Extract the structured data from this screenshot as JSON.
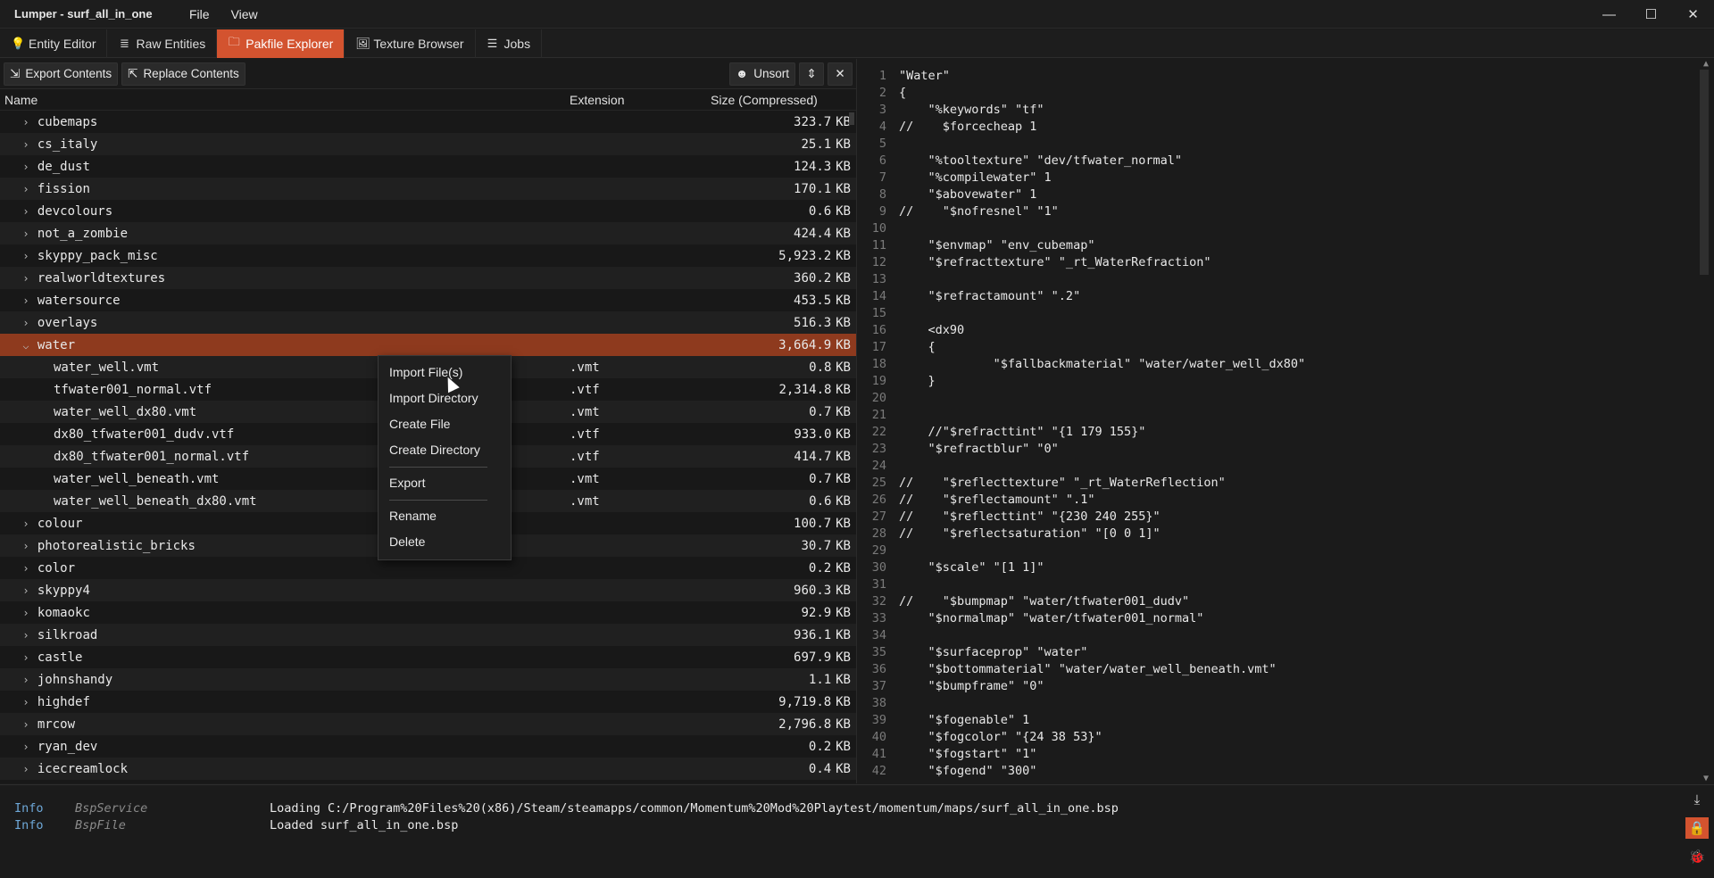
{
  "titlebar": {
    "title": "Lumper - surf_all_in_one",
    "menu": [
      "File",
      "View"
    ],
    "controls": {
      "minimize": "—",
      "maximize": "☐",
      "close": "✕"
    }
  },
  "tabs": [
    {
      "label": "Entity Editor",
      "icon": "bulb-icon",
      "glyph": "💡",
      "active": false
    },
    {
      "label": "Raw Entities",
      "icon": "list-icon",
      "glyph": "≣",
      "active": false
    },
    {
      "label": "Pakfile Explorer",
      "icon": "folder-icon",
      "glyph": "🗀",
      "active": true
    },
    {
      "label": "Texture Browser",
      "icon": "image-icon",
      "glyph": "🖼",
      "active": false
    },
    {
      "label": "Jobs",
      "icon": "jobs-icon",
      "glyph": "☰",
      "active": false
    }
  ],
  "toolbar": {
    "export_label": "Export Contents",
    "replace_label": "Replace Contents",
    "unsort_label": "Unsort"
  },
  "columns": {
    "name": "Name",
    "extension": "Extension",
    "size": "Size (Compressed)"
  },
  "rows": [
    {
      "name": "cubemaps",
      "ext": "",
      "size": "323.7",
      "unit": "KB",
      "type": "folder"
    },
    {
      "name": "cs_italy",
      "ext": "",
      "size": "25.1",
      "unit": "KB",
      "type": "folder"
    },
    {
      "name": "de_dust",
      "ext": "",
      "size": "124.3",
      "unit": "KB",
      "type": "folder"
    },
    {
      "name": "fission",
      "ext": "",
      "size": "170.1",
      "unit": "KB",
      "type": "folder"
    },
    {
      "name": "devcolours",
      "ext": "",
      "size": "0.6",
      "unit": "KB",
      "type": "folder"
    },
    {
      "name": "not_a_zombie",
      "ext": "",
      "size": "424.4",
      "unit": "KB",
      "type": "folder"
    },
    {
      "name": "skyppy_pack_misc",
      "ext": "",
      "size": "5,923.2",
      "unit": "KB",
      "type": "folder"
    },
    {
      "name": "realworldtextures",
      "ext": "",
      "size": "360.2",
      "unit": "KB",
      "type": "folder"
    },
    {
      "name": "watersource",
      "ext": "",
      "size": "453.5",
      "unit": "KB",
      "type": "folder"
    },
    {
      "name": "overlays",
      "ext": "",
      "size": "516.3",
      "unit": "KB",
      "type": "folder"
    },
    {
      "name": "water",
      "ext": "",
      "size": "3,664.9",
      "unit": "KB",
      "type": "open",
      "selected": true
    },
    {
      "name": "water_well.vmt",
      "ext": ".vmt",
      "size": "0.8",
      "unit": "KB",
      "type": "file"
    },
    {
      "name": "tfwater001_normal.vtf",
      "ext": ".vtf",
      "size": "2,314.8",
      "unit": "KB",
      "type": "file"
    },
    {
      "name": "water_well_dx80.vmt",
      "ext": ".vmt",
      "size": "0.7",
      "unit": "KB",
      "type": "file"
    },
    {
      "name": "dx80_tfwater001_dudv.vtf",
      "ext": ".vtf",
      "size": "933.0",
      "unit": "KB",
      "type": "file"
    },
    {
      "name": "dx80_tfwater001_normal.vtf",
      "ext": ".vtf",
      "size": "414.7",
      "unit": "KB",
      "type": "file"
    },
    {
      "name": "water_well_beneath.vmt",
      "ext": ".vmt",
      "size": "0.7",
      "unit": "KB",
      "type": "file"
    },
    {
      "name": "water_well_beneath_dx80.vmt",
      "ext": ".vmt",
      "size": "0.6",
      "unit": "KB",
      "type": "file"
    },
    {
      "name": "colour",
      "ext": "",
      "size": "100.7",
      "unit": "KB",
      "type": "folder"
    },
    {
      "name": "photorealistic_bricks",
      "ext": "",
      "size": "30.7",
      "unit": "KB",
      "type": "folder"
    },
    {
      "name": "color",
      "ext": "",
      "size": "0.2",
      "unit": "KB",
      "type": "folder"
    },
    {
      "name": "skyppy4",
      "ext": "",
      "size": "960.3",
      "unit": "KB",
      "type": "folder"
    },
    {
      "name": "komaokc",
      "ext": "",
      "size": "92.9",
      "unit": "KB",
      "type": "folder"
    },
    {
      "name": "silkroad",
      "ext": "",
      "size": "936.1",
      "unit": "KB",
      "type": "folder"
    },
    {
      "name": "castle",
      "ext": "",
      "size": "697.9",
      "unit": "KB",
      "type": "folder"
    },
    {
      "name": "johnshandy",
      "ext": "",
      "size": "1.1",
      "unit": "KB",
      "type": "folder"
    },
    {
      "name": "highdef",
      "ext": "",
      "size": "9,719.8",
      "unit": "KB",
      "type": "folder"
    },
    {
      "name": "mrcow",
      "ext": "",
      "size": "2,796.8",
      "unit": "KB",
      "type": "folder"
    },
    {
      "name": "ryan_dev",
      "ext": "",
      "size": "0.2",
      "unit": "KB",
      "type": "folder"
    },
    {
      "name": "icecreamlock",
      "ext": "",
      "size": "0.4",
      "unit": "KB",
      "type": "folder"
    }
  ],
  "context_menu": {
    "groups": [
      [
        "Import File(s)",
        "Import Directory",
        "Create File",
        "Create Directory"
      ],
      [
        "Export"
      ],
      [
        "Rename",
        "Delete"
      ]
    ]
  },
  "editor": {
    "lines": [
      "\"Water\"",
      "{",
      "    \"%keywords\" \"tf\"",
      "//    $forcecheap 1",
      "",
      "    \"%tooltexture\" \"dev/tfwater_normal\"",
      "    \"%compilewater\" 1",
      "    \"$abovewater\" 1",
      "//    \"$nofresnel\" \"1\"",
      "",
      "    \"$envmap\" \"env_cubemap\"",
      "    \"$refracttexture\" \"_rt_WaterRefraction\"",
      "",
      "    \"$refractamount\" \".2\"",
      "",
      "    <dx90",
      "    {",
      "             \"$fallbackmaterial\" \"water/water_well_dx80\"",
      "    }",
      "",
      "",
      "    //\"$refracttint\" \"{1 179 155}\"",
      "    \"$refractblur\" \"0\"",
      "",
      "//    \"$reflecttexture\" \"_rt_WaterReflection\"",
      "//    \"$reflectamount\" \".1\"",
      "//    \"$reflecttint\" \"{230 240 255}\"",
      "//    \"$reflectsaturation\" \"[0 0 1]\"",
      "",
      "    \"$scale\" \"[1 1]\"",
      "",
      "//    \"$bumpmap\" \"water/tfwater001_dudv\"",
      "    \"$normalmap\" \"water/tfwater001_normal\"",
      "",
      "    \"$surfaceprop\" \"water\"",
      "    \"$bottommaterial\" \"water/water_well_beneath.vmt\"",
      "    \"$bumpframe\" \"0\"",
      "",
      "    \"$fogenable\" 1",
      "    \"$fogcolor\" \"{24 38 53}\"",
      "    \"$fogstart\" \"1\"",
      "    \"$fogend\" \"300\""
    ]
  },
  "log": [
    {
      "level": "Info",
      "source": "BspService",
      "message": "Loading C:/Program%20Files%20(x86)/Steam/steamapps/common/Momentum%20Mod%20Playtest/momentum/maps/surf_all_in_one.bsp"
    },
    {
      "level": "Info",
      "source": "BspFile",
      "message": "Loaded surf_all_in_one.bsp"
    }
  ],
  "colors": {
    "accent": "#d3532f",
    "selected_row": "#8e3a1e",
    "background": "#1b1b1b"
  }
}
